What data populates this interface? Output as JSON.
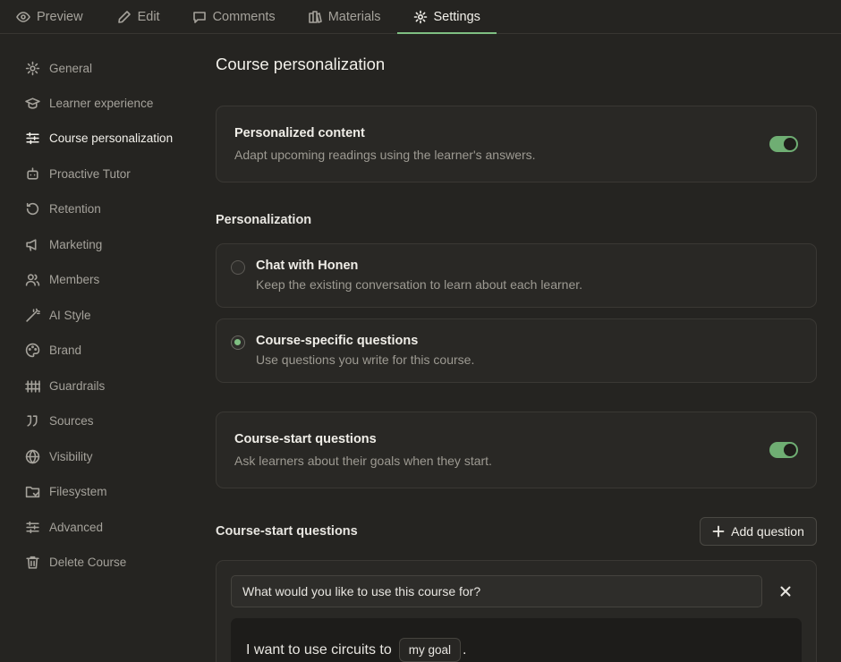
{
  "tabs": [
    {
      "label": "Preview",
      "icon": "eye-icon"
    },
    {
      "label": "Edit",
      "icon": "pencil-icon"
    },
    {
      "label": "Comments",
      "icon": "comment-icon"
    },
    {
      "label": "Materials",
      "icon": "materials-icon"
    },
    {
      "label": "Settings",
      "icon": "gear-icon",
      "active": true
    }
  ],
  "sidebar": {
    "items": [
      {
        "label": "General",
        "icon": "gear-icon"
      },
      {
        "label": "Learner experience",
        "icon": "graduation-cap-icon"
      },
      {
        "label": "Course personalization",
        "icon": "sliders-icon",
        "active": true
      },
      {
        "label": "Proactive Tutor",
        "icon": "robot-icon"
      },
      {
        "label": "Retention",
        "icon": "rotate-icon"
      },
      {
        "label": "Marketing",
        "icon": "megaphone-icon"
      },
      {
        "label": "Members",
        "icon": "users-icon"
      },
      {
        "label": "AI Style",
        "icon": "magic-wand-icon"
      },
      {
        "label": "Brand",
        "icon": "palette-icon"
      },
      {
        "label": "Guardrails",
        "icon": "fence-icon"
      },
      {
        "label": "Sources",
        "icon": "quote-icon"
      },
      {
        "label": "Visibility",
        "icon": "globe-icon"
      },
      {
        "label": "Filesystem",
        "icon": "folder-icon"
      },
      {
        "label": "Advanced",
        "icon": "sliders-icon"
      },
      {
        "label": "Delete Course",
        "icon": "trash-icon"
      }
    ]
  },
  "main": {
    "title": "Course personalization",
    "personalized_content": {
      "title": "Personalized content",
      "description": "Adapt upcoming readings using the learner's answers.",
      "enabled": true
    },
    "personalization": {
      "label": "Personalization",
      "options": [
        {
          "title": "Chat with Honen",
          "description": "Keep the existing conversation to learn about each learner.",
          "selected": false
        },
        {
          "title": "Course-specific questions",
          "description": "Use questions you write for this course.",
          "selected": true
        }
      ]
    },
    "course_start_toggle": {
      "title": "Course-start questions",
      "description": "Ask learners about their goals when they start.",
      "enabled": true
    },
    "questions_section": {
      "label": "Course-start questions",
      "add_button": "Add question",
      "question_value": "What would you like to use this course for?",
      "preview": {
        "prefix": "I want to use circuits to",
        "chip": "my goal",
        "suffix": "."
      }
    }
  },
  "colors": {
    "background": "#252421",
    "accent": "#7fbf82",
    "toggle_on": "#6fae73"
  }
}
